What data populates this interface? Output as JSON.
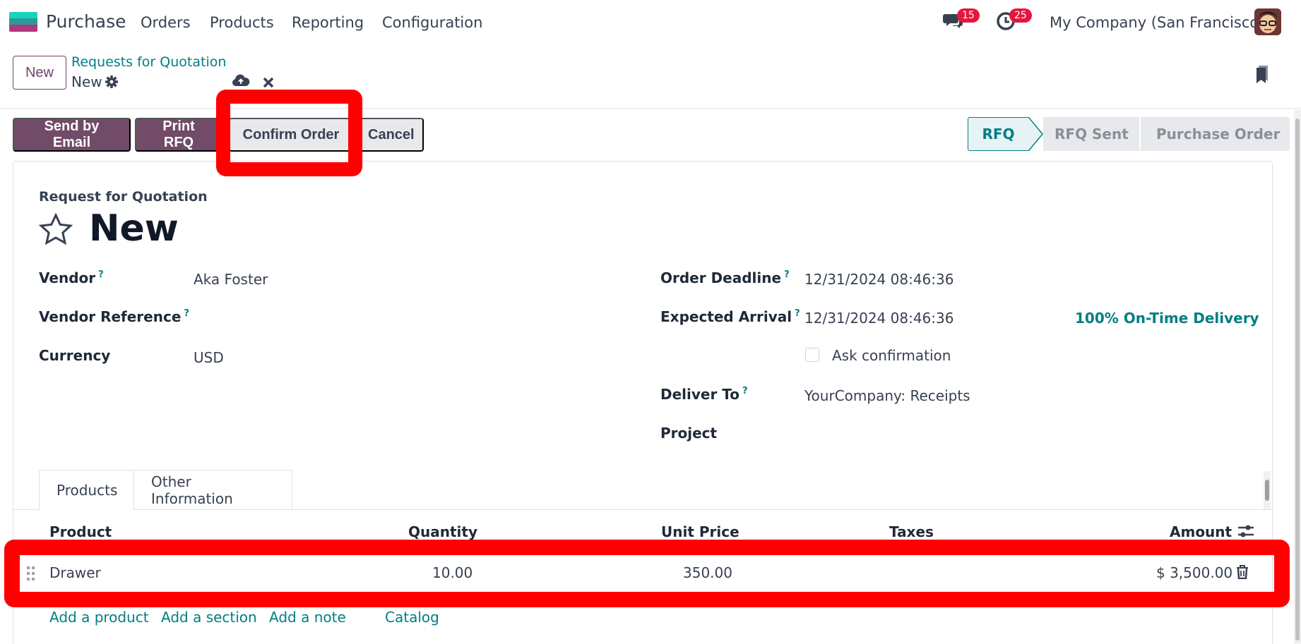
{
  "app": {
    "name": "Purchase",
    "menu": [
      "Orders",
      "Products",
      "Reporting",
      "Configuration"
    ],
    "messages_count": "15",
    "activities_count": "25",
    "company": "My Company (San Francisco)"
  },
  "control": {
    "new_label": "New",
    "breadcrumb_parent": "Requests for Quotation",
    "breadcrumb_current": "New"
  },
  "actions": {
    "send_email": "Send by Email",
    "print_rfq": "Print RFQ",
    "confirm_order": "Confirm Order",
    "cancel": "Cancel"
  },
  "status": {
    "stages": [
      "RFQ",
      "RFQ Sent",
      "Purchase Order"
    ],
    "active": "RFQ"
  },
  "form": {
    "doc_type": "Request for Quotation",
    "title": "New",
    "vendor_label": "Vendor",
    "vendor": "Aka Foster",
    "vendor_ref_label": "Vendor Reference",
    "vendor_ref": "",
    "currency_label": "Currency",
    "currency": "USD",
    "order_deadline_label": "Order Deadline",
    "order_deadline": "12/31/2024 08:46:36",
    "expected_arrival_label": "Expected Arrival",
    "expected_arrival": "12/31/2024 08:46:36",
    "on_time": "100% On-Time Delivery",
    "ask_confirmation": "Ask confirmation",
    "deliver_to_label": "Deliver To",
    "deliver_to": "YourCompany: Receipts",
    "project_label": "Project",
    "help_mark": "?"
  },
  "tabs": [
    "Products",
    "Other Information"
  ],
  "lines": {
    "headers": [
      "Product",
      "Quantity",
      "Unit Price",
      "Taxes",
      "Amount"
    ],
    "rows": [
      {
        "product": "Drawer",
        "quantity": "10.00",
        "unit_price": "350.00",
        "taxes": "",
        "amount": "$ 3,500.00"
      }
    ],
    "add_product": "Add a product",
    "add_section": "Add a section",
    "add_note": "Add a note",
    "catalog": "Catalog"
  },
  "colors": {
    "brand": "#714b67",
    "link": "#017e84",
    "highlight": "#ff0000"
  }
}
